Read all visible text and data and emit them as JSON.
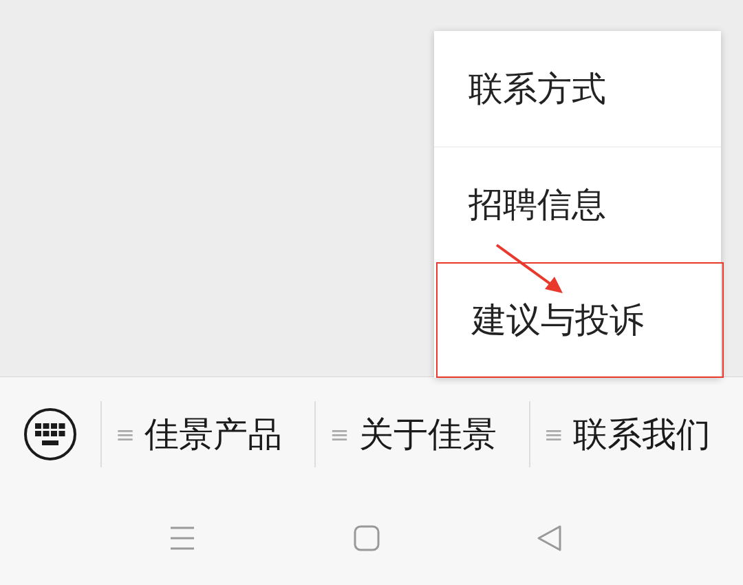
{
  "popup_menu": {
    "items": [
      {
        "label": "联系方式",
        "annotated": false
      },
      {
        "label": "招聘信息",
        "annotated": false
      },
      {
        "label": "建议与投诉",
        "annotated": true
      }
    ]
  },
  "menu_bar": {
    "items": [
      {
        "glyph": "≡",
        "label": "佳景产品"
      },
      {
        "glyph": "≡",
        "label": "关于佳景"
      },
      {
        "glyph": "≡",
        "label": "联系我们"
      }
    ]
  }
}
